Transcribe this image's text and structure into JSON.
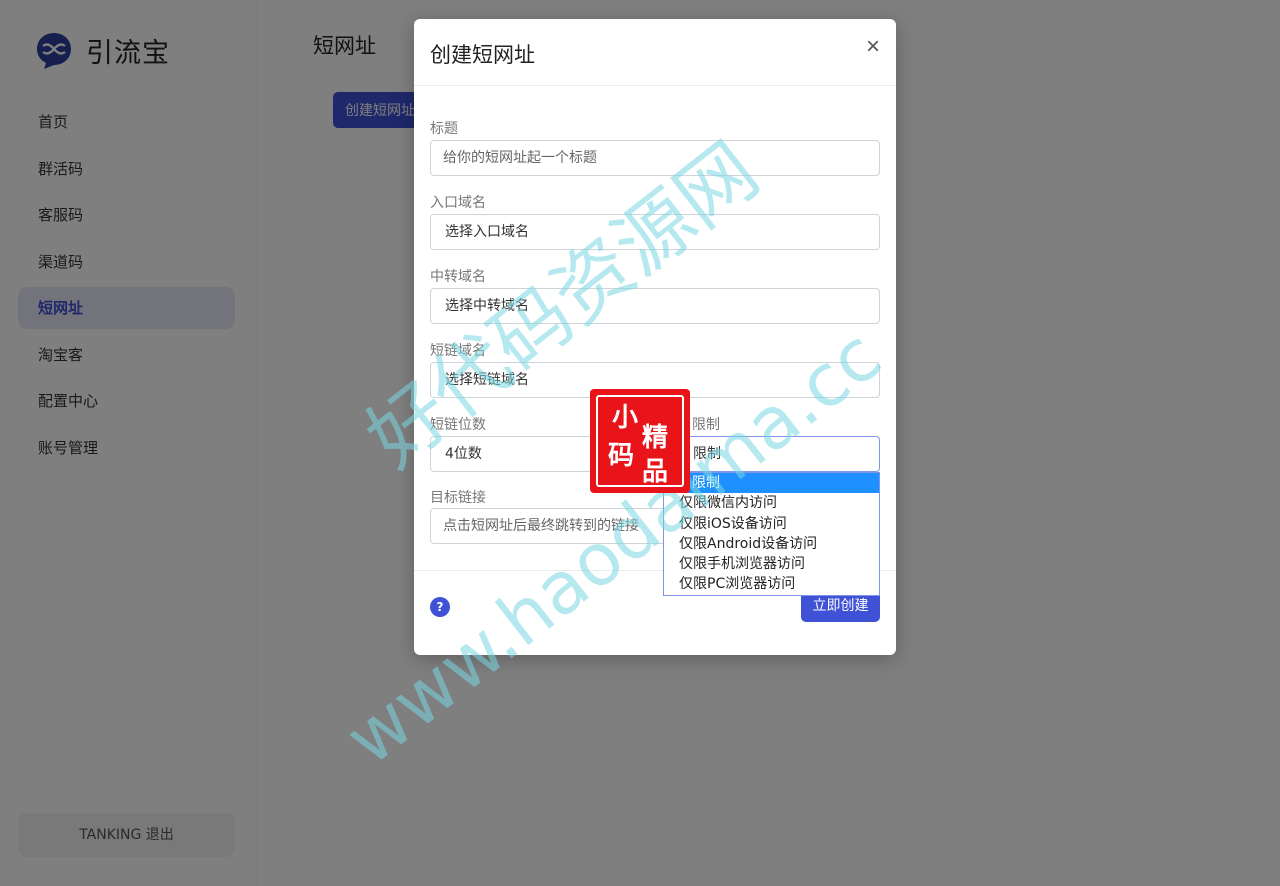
{
  "app": {
    "brand_name": "引流宝"
  },
  "sidebar": {
    "items": [
      {
        "label": "首页"
      },
      {
        "label": "群活码"
      },
      {
        "label": "客服码"
      },
      {
        "label": "渠道码"
      },
      {
        "label": "短网址",
        "active": true
      },
      {
        "label": "淘宝客"
      },
      {
        "label": "配置中心"
      },
      {
        "label": "账号管理"
      }
    ],
    "logout_label": "TANKING  退出"
  },
  "main": {
    "title": "短网址",
    "create_button_label": "创建短网址"
  },
  "modal": {
    "title": "创建短网址",
    "close_glyph": "×",
    "fields": {
      "title_label": "标题",
      "title_placeholder": "给你的短网址起一个标题",
      "entry_domain_label": "入口域名",
      "entry_domain_value": "选择入口域名",
      "transfer_domain_label": "中转域名",
      "transfer_domain_value": "选择中转域名",
      "short_domain_label": "短链域名",
      "short_domain_value": "选择短链域名",
      "digits_label": "短链位数",
      "digits_value": "4位数",
      "restrict_label": "限制",
      "restrict_value": "限制",
      "target_label": "目标链接",
      "target_placeholder": "点击短网址后最终跳转到的链接"
    },
    "dropdown_options": [
      "限制",
      "仅限微信内访问",
      "仅限iOS设备访问",
      "仅限Android设备访问",
      "仅限手机浏览器访问",
      "仅限PC浏览器访问"
    ],
    "help_glyph": "?",
    "submit_label": "立即创建"
  },
  "watermark": {
    "line1": "好代码资源网",
    "line2": "www.haodaima.cc",
    "seal_chars": [
      "小",
      "精",
      "码",
      "品"
    ]
  },
  "colors": {
    "accent": "#3f51d4",
    "dropdown_highlight": "#1e90ff",
    "seal_red": "#e8141a",
    "watermark": "#78d7e1"
  }
}
